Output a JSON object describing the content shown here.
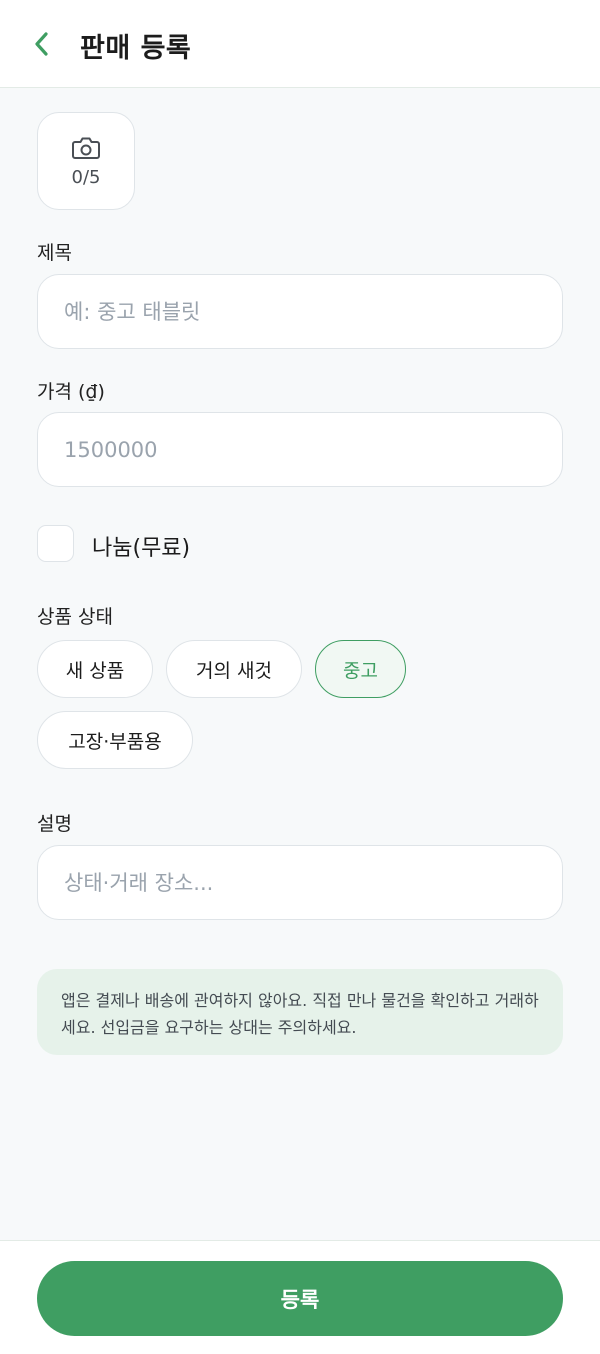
{
  "header": {
    "title": "판매 등록",
    "back_icon": "chevron-left-icon"
  },
  "photos": {
    "count_label": "0/5",
    "icon": "camera-icon"
  },
  "title_field": {
    "label": "제목",
    "value": "",
    "placeholder": "예: 중고 태블릿"
  },
  "price_field": {
    "label": "가격 (₫)",
    "value": "",
    "placeholder": "1500000"
  },
  "free_option": {
    "label": "나눔(무료)",
    "checked": false
  },
  "condition": {
    "label": "상품 상태",
    "options": [
      "새 상품",
      "거의 새것",
      "중고",
      "고장·부품용"
    ],
    "selected": "중고"
  },
  "description_field": {
    "label": "설명",
    "value": "",
    "placeholder": "상태·거래 장소..."
  },
  "notice": {
    "text": "앱은 결제나 배송에 관여하지 않아요. 직접 만나 물건을 확인하고 거래하세요. 선입금을 요구하는 상대는 주의하세요."
  },
  "submit": {
    "label": "등록"
  },
  "colors": {
    "accent": "#3f9e62",
    "notice_bg": "#e6f2ea",
    "background": "#f7f9fa"
  }
}
